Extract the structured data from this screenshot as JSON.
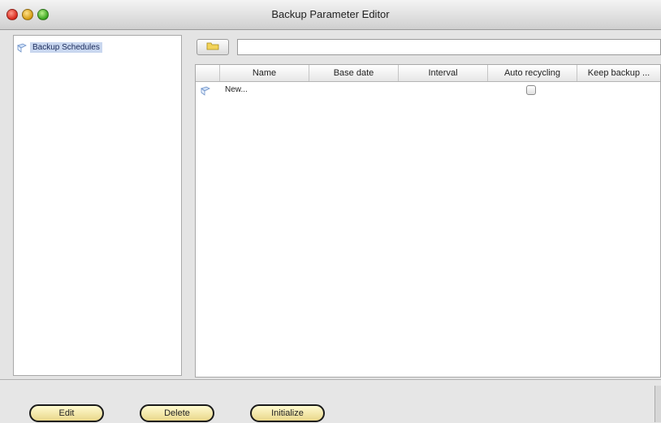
{
  "window": {
    "title": "Backup Parameter Editor"
  },
  "tree": {
    "items": [
      {
        "label": "Backup Schedules"
      }
    ]
  },
  "path": {
    "value": ""
  },
  "table": {
    "headers": [
      "Name",
      "Base date",
      "Interval",
      "Auto recycling",
      "Keep backup ..."
    ],
    "rows": [
      {
        "name": "New...",
        "base_date": "",
        "interval": "",
        "auto_recycling": false,
        "keep_backup": ""
      }
    ]
  },
  "buttons": {
    "edit": "Edit",
    "delete": "Delete",
    "initialize": "Initialize"
  },
  "colors": {
    "selection": "#c9d7ef",
    "button_fill": "#f4e7a8",
    "button_border": "#1a1a1a"
  },
  "icons": {
    "window_close": "close-icon",
    "window_minimize": "minimize-icon",
    "window_zoom": "zoom-icon",
    "folder": "folder-icon",
    "document": "document-icon"
  }
}
